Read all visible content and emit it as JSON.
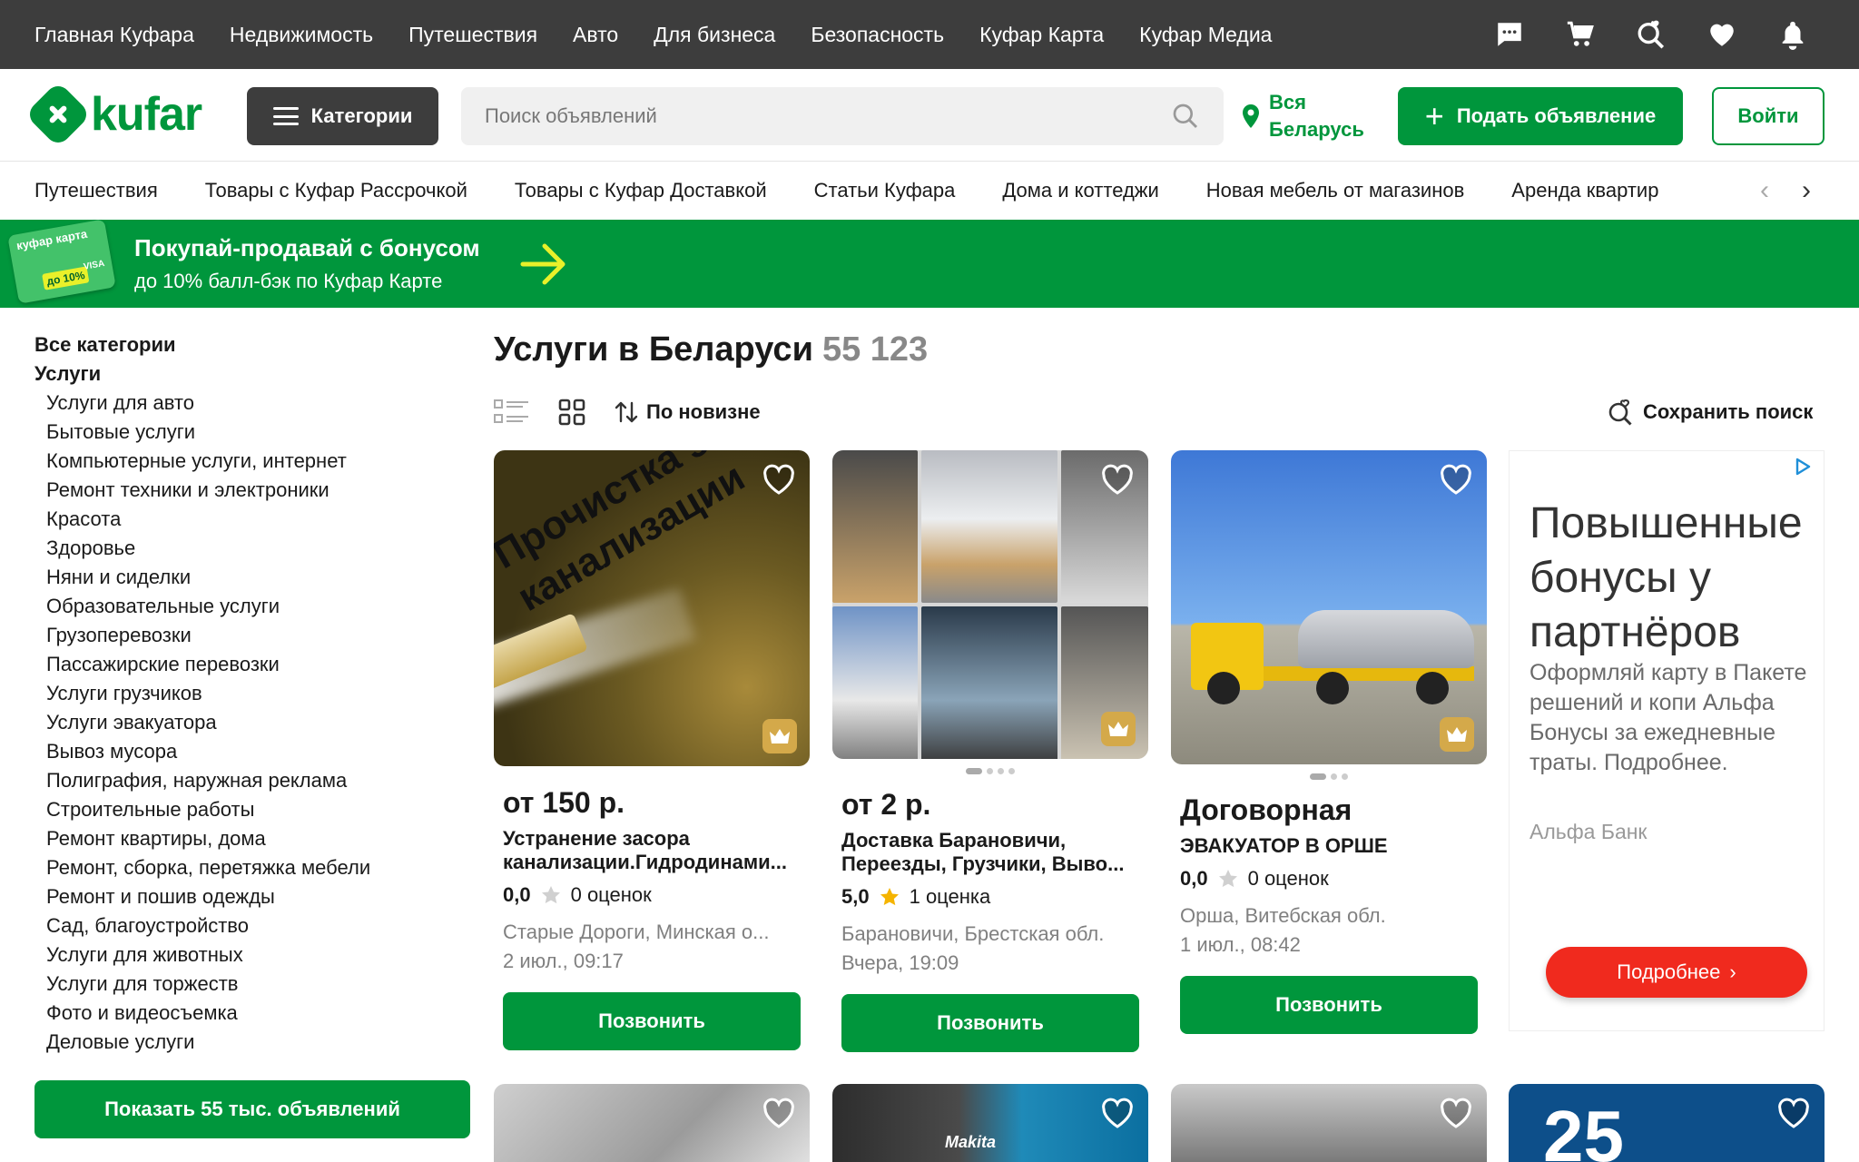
{
  "topnav": {
    "items": [
      "Главная Куфара",
      "Недвижимость",
      "Путешествия",
      "Авто",
      "Для бизнеса",
      "Безопасность",
      "Куфар Карта",
      "Куфар Медиа"
    ],
    "icons": [
      "chat-icon",
      "cart-icon",
      "saved-search-icon",
      "heart-icon",
      "bell-icon"
    ]
  },
  "header": {
    "logo_text": "kufar",
    "categories_label": "Категории",
    "search_placeholder": "Поиск объявлений",
    "region_label": "Вся Беларусь",
    "post_label": "Подать объявление",
    "login_label": "Войти"
  },
  "quicklinks": [
    "Путешествия",
    "Товары с Куфар Рассрочкой",
    "Товары с Куфар Доставкой",
    "Статьи Куфара",
    "Дома и коттеджи",
    "Новая мебель от магазинов",
    "Аренда квартир"
  ],
  "banner": {
    "card_text": "куфар карта",
    "card_badge": "до 10%",
    "card_network": "VISA",
    "title": "Покупай-продавай с бонусом",
    "subtitle": "до 10% балл-бэк по Куфар Карте"
  },
  "sidebar": {
    "all_label": "Все категории",
    "current": "Услуги",
    "items": [
      "Услуги для авто",
      "Бытовые услуги",
      "Компьютерные услуги, интернет",
      "Ремонт техники и электроники",
      "Красота",
      "Здоровье",
      "Няни и сиделки",
      "Образовательные услуги",
      "Грузоперевозки",
      "Пассажирские перевозки",
      "Услуги грузчиков",
      "Услуги эвакуатора",
      "Вывоз мусора",
      "Полиграфия, наружная реклама",
      "Строительные работы",
      "Ремонт квартиры, дома",
      "Ремонт, сборка, перетяжка мебели",
      "Ремонт и пошив одежды",
      "Сад, благоустройство",
      "Услуги для животных",
      "Услуги для торжеств",
      "Фото и видеосъемка",
      "Деловые услуги"
    ],
    "show_button": "Показать 55 тыс. объявлений"
  },
  "main": {
    "title": "Услуги в Беларуси",
    "count": "55 123",
    "sort_label": "По новизне",
    "save_search_label": "Сохранить поиск"
  },
  "listings": [
    {
      "photo_text": "Прочистка засора канализации",
      "price": "от 150 р.",
      "title": "Устранение засора канализации.Гидродинами...",
      "rating": "0,0",
      "reviews": "0 оценок",
      "location": "Старые Дороги, Минская о...",
      "date": "2 июл., 09:17",
      "call_label": "Позвонить"
    },
    {
      "price": "от 2 р.",
      "title": "Доставка Барановичи, Переезды, Грузчики, Выво...",
      "rating": "5,0",
      "reviews": "1 оценка",
      "location": "Барановичи, Брестская обл.",
      "date": "Вчера, 19:09",
      "call_label": "Позвонить"
    },
    {
      "price": "Договорная",
      "title": "ЭВАКУАТОР В ОРШЕ",
      "rating": "0,0",
      "reviews": "0 оценок",
      "location": "Орша, Витебская обл.",
      "date": "1 июл., 08:42",
      "call_label": "Позвонить"
    }
  ],
  "ad": {
    "headline": "Повышенные бонусы у партнёров",
    "text": "Оформляй карту в Пакете решений и копи Альфа Бонусы за ежедневные траты. Подробнее.",
    "sponsor": "Альфа Банк",
    "button": "Подробнее"
  },
  "second_row": {
    "tile2_brand": "Makita",
    "tile4_number": "25"
  },
  "colors": {
    "brand_green": "#00963c",
    "dark_bar": "#3d3d3d",
    "ad_red": "#f02a1e",
    "star_gold": "#f5b400"
  }
}
